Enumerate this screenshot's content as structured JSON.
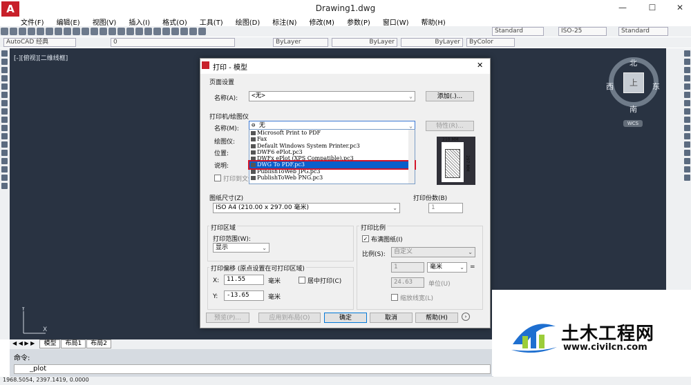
{
  "window": {
    "title": "Drawing1.dwg",
    "logo": "A"
  },
  "menu": [
    "文件(F)",
    "编辑(E)",
    "视图(V)",
    "插入(I)",
    "格式(O)",
    "工具(T)",
    "绘图(D)",
    "标注(N)",
    "修改(M)",
    "参数(P)",
    "窗口(W)",
    "帮助(H)"
  ],
  "toolbar1": {
    "text_style": "Standard",
    "dim_style": "ISO-25",
    "table_style": "Standard"
  },
  "toolbar2": {
    "workspace": "AutoCAD 经典",
    "layer": "0",
    "color": "ByLayer",
    "linetype": "ByLayer",
    "lineweight": "ByLayer",
    "plotstyle": "ByColor"
  },
  "viewport": {
    "label": "[-][俯视][二维线框]"
  },
  "viewcube": {
    "north": "北",
    "south": "南",
    "east": "东",
    "west": "西",
    "top": "上",
    "wcs": "WCS"
  },
  "ucs": {
    "y": "Y",
    "x": "X"
  },
  "sheet_tabs": [
    "模型",
    "布局1",
    "布局2"
  ],
  "command": {
    "label": "命令:",
    "input": "_plot"
  },
  "status": {
    "coords": "1968.5054, 2397.1419, 0.0000"
  },
  "dialog": {
    "title": "打印 - 模型",
    "page_setup": {
      "group": "页面设置",
      "name_label": "名称(A):",
      "name_value": "<无>",
      "add_btn": "添加(.)..."
    },
    "printer": {
      "group": "打印机/绘图仪",
      "name_label": "名称(M):",
      "name_value": "无",
      "properties_btn": "特性(R)...",
      "plotter_label": "绘图仪:",
      "location_label": "位置:",
      "desc_label": "说明:",
      "print_to_file": "打印到文件",
      "options": [
        "Microsoft Print to PDF",
        "Fax",
        "Default Windows System Printer.pc3",
        "DWF6 ePlot.pc3",
        "DWFx ePlot (XPS Compatible).pc3",
        "DWG To PDF.pc3",
        "PublishToWeb JPG.pc3",
        "PublishToWeb PNG.pc3"
      ],
      "selected_index": 5,
      "preview_w": "210 MM",
      "preview_h": "297 MM"
    },
    "paper_size": {
      "group": "图纸尺寸(Z)",
      "value": "ISO A4 (210.00 x 297.00 毫米)"
    },
    "copies": {
      "group": "打印份数(B)",
      "value": "1"
    },
    "plot_area": {
      "group": "打印区域",
      "range_label": "打印范围(W):",
      "range_value": "显示"
    },
    "plot_offset": {
      "group": "打印偏移 (原点设置在可打印区域)",
      "x_label": "X:",
      "x_value": "11.55",
      "y_label": "Y:",
      "y_value": "-13.65",
      "unit": "毫米",
      "center_label": "居中打印(C)"
    },
    "plot_scale": {
      "group": "打印比例",
      "fit_label": "布满图纸(I)",
      "fit_checked": true,
      "scale_label": "比例(S):",
      "scale_value": "自定义",
      "num": "1",
      "num_unit": "毫米",
      "eq": "=",
      "den": "24.63",
      "den_unit": "单位(U)",
      "lineweight": "缩放线宽(L)"
    },
    "buttons": {
      "preview": "预览(P)...",
      "apply": "应用到布局(O)",
      "ok": "确定",
      "cancel": "取消",
      "help": "帮助(H)"
    }
  },
  "watermark": {
    "title": "土木工程网",
    "url": "www.civilcn.com"
  }
}
